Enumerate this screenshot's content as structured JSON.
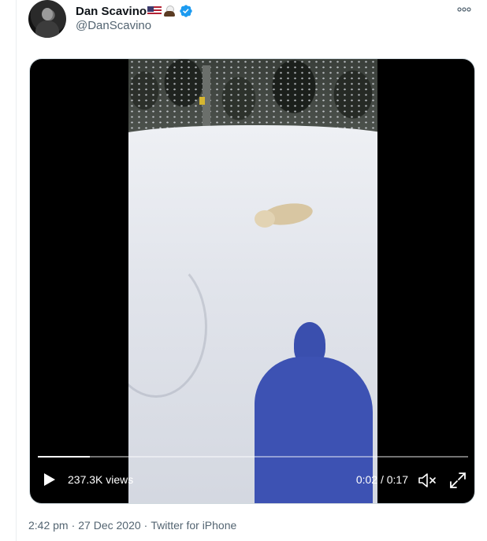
{
  "tweet": {
    "author": {
      "display_name": "Dan Scavino",
      "handle": "@DanScavino",
      "verified": true,
      "emojis": [
        "us-flag-emoji",
        "eagle-emoji"
      ]
    },
    "more_icon": "more-horizontal-icon",
    "media": {
      "kind": "video",
      "views": "237.3K views",
      "current_time": "0:02",
      "separator": "/",
      "duration": "0:17",
      "progress_fraction": 0.12,
      "icons": [
        "play-icon",
        "volume-muted-icon",
        "fullscreen-icon"
      ]
    },
    "meta": {
      "time": "2:42 pm",
      "date": "27 Dec 2020",
      "source": "Twitter for iPhone",
      "separator": "·"
    }
  },
  "colors": {
    "verified_blue": "#1d9bf0",
    "secondary_text": "#536471",
    "primary_text": "#0f1419"
  }
}
